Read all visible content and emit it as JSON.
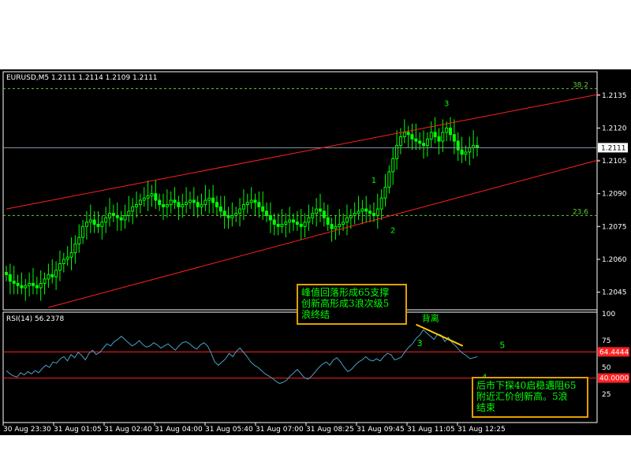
{
  "window": {
    "symbol_header": "EURUSD,M5  1.2111 1.2114 1.2109 1.2111",
    "current_price_label": "1.2111"
  },
  "colors": {
    "background": "#000000",
    "candles": "#00ff00",
    "channel_lines": "#ff2020",
    "fib_lines": "#66cc33",
    "rsi_line": "#4aa3c7",
    "rsi_levels": "#ff2020",
    "divergence_line": "#ffcc00",
    "box_border": "#e0a000",
    "axis_text": "#ffffff"
  },
  "chart_data": [
    {
      "type": "candlestick",
      "title": "EURUSD,M5",
      "ohlc": {
        "open": 1.2111,
        "high": 1.2114,
        "low": 1.2109,
        "close": 1.2111
      },
      "ylim": [
        1.2038,
        1.2145
      ],
      "y_ticks": [
        "1.2135",
        "1.2120",
        "1.2105",
        "1.2090",
        "1.2075",
        "1.2060",
        "1.2045"
      ],
      "x_ticks": [
        "30 Aug 23:30",
        "31 Aug 01:05",
        "31 Aug 02:40",
        "31 Aug 04:00",
        "31 Aug 05:40",
        "31 Aug 07:00",
        "31 Aug 08:25",
        "31 Aug 09:45",
        "31 Aug 11:05",
        "31 Aug 12:25"
      ],
      "close_series": [
        1.2053,
        1.205,
        1.2049,
        1.2048,
        1.2047,
        1.2048,
        1.2049,
        1.2048,
        1.2047,
        1.2049,
        1.2051,
        1.2053,
        1.2052,
        1.2055,
        1.2058,
        1.206,
        1.2061,
        1.2063,
        1.2067,
        1.207,
        1.2075,
        1.2077,
        1.2078,
        1.2076,
        1.2075,
        1.2077,
        1.2079,
        1.2081,
        1.208,
        1.2079,
        1.2078,
        1.208,
        1.2082,
        1.2084,
        1.2085,
        1.2087,
        1.2088,
        1.2089,
        1.209,
        1.2087,
        1.2085,
        1.2084,
        1.2085,
        1.2087,
        1.2086,
        1.2084,
        1.2085,
        1.2086,
        1.2087,
        1.2086,
        1.2084,
        1.2085,
        1.2087,
        1.2088,
        1.2086,
        1.2084,
        1.2082,
        1.208,
        1.2079,
        1.208,
        1.2081,
        1.2083,
        1.2085,
        1.2086,
        1.2087,
        1.2086,
        1.2084,
        1.2082,
        1.208,
        1.2078,
        1.2076,
        1.2075,
        1.2076,
        1.2077,
        1.2078,
        1.2077,
        1.2076,
        1.2075,
        1.2077,
        1.2079,
        1.2081,
        1.2083,
        1.2082,
        1.2079,
        1.2076,
        1.2074,
        1.2075,
        1.2076,
        1.2077,
        1.2079,
        1.208,
        1.2081,
        1.2082,
        1.2083,
        1.2082,
        1.2081,
        1.208,
        1.2083,
        1.2088,
        1.2093,
        1.21,
        1.2106,
        1.2112,
        1.2116,
        1.2118,
        1.2117,
        1.2115,
        1.2114,
        1.2113,
        1.2112,
        1.2115,
        1.2118,
        1.2116,
        1.2114,
        1.2118,
        1.212,
        1.2117,
        1.2114,
        1.211,
        1.2108,
        1.2109,
        1.2111,
        1.2112,
        1.2111
      ],
      "reference_price": {
        "value": 1.2111,
        "label": "1.2111"
      },
      "fibonacci_levels": [
        {
          "value": 1.2138,
          "label": "38.2"
        },
        {
          "value": 1.208,
          "label": "23.6"
        }
      ],
      "channel_lines": [
        {
          "from": [
            0,
            1.2083
          ],
          "to": [
            124,
            1.2125
          ]
        },
        {
          "from": [
            11,
            1.2038
          ],
          "to": [
            124,
            1.2091
          ]
        }
      ],
      "wave_labels": [
        {
          "text": "1",
          "index": 96,
          "price": 1.2095
        },
        {
          "text": "2",
          "index": 101,
          "price": 1.2072
        },
        {
          "text": "3",
          "index": 115,
          "price": 1.213
        }
      ]
    },
    {
      "type": "line",
      "title": "RSI(14)",
      "header": "RSI(14)  56.2378",
      "current_value": 56.2378,
      "ylim": [
        0,
        100
      ],
      "y_ticks": [
        "100",
        "75",
        "50",
        "25"
      ],
      "levels": [
        {
          "value": 64.4444,
          "label": "64.4444"
        },
        {
          "value": 40.0,
          "label": "40.0000"
        }
      ],
      "values": [
        47,
        44,
        42,
        41,
        45,
        43,
        46,
        44,
        47,
        45,
        49,
        52,
        50,
        55,
        54,
        58,
        60,
        56,
        62,
        59,
        64,
        61,
        57,
        63,
        66,
        62,
        64,
        68,
        72,
        70,
        74,
        76,
        79,
        76,
        73,
        70,
        72,
        75,
        71,
        69,
        70,
        73,
        71,
        68,
        70,
        72,
        69,
        66,
        70,
        73,
        74,
        72,
        69,
        67,
        71,
        73,
        70,
        63,
        55,
        52,
        55,
        58,
        63,
        60,
        65,
        68,
        64,
        60,
        55,
        52,
        50,
        47,
        44,
        42,
        40,
        37,
        35,
        36,
        38,
        42,
        45,
        48,
        44,
        40,
        39,
        42,
        46,
        50,
        53,
        55,
        52,
        57,
        59,
        55,
        50,
        46,
        48,
        52,
        55,
        57,
        60,
        57,
        56,
        58,
        56,
        60,
        63,
        62,
        57,
        58,
        60,
        65,
        69,
        72,
        77,
        80,
        85,
        82,
        79,
        76,
        81,
        80,
        74,
        78,
        73,
        70,
        66,
        63,
        61,
        58,
        59,
        60
      ],
      "wave_labels": [
        {
          "text": "3",
          "index": 115,
          "value": 70
        },
        {
          "text": "4",
          "index": 133,
          "value": 38
        },
        {
          "text": "5",
          "index": 138,
          "value": 68
        },
        {
          "text": "背离",
          "index": 118,
          "value": 93
        }
      ],
      "divergence_line": {
        "from": [
          114,
          90
        ],
        "to": [
          127,
          70
        ]
      }
    }
  ],
  "annotations": {
    "box1_lines": [
      "峰值回落形成65支撑",
      "创新高形成3浪次级5",
      "浪终结"
    ],
    "box2_lines": [
      "后市下探40启稳遇阻65",
      "附近汇价创新高。5浪",
      "结束"
    ]
  }
}
